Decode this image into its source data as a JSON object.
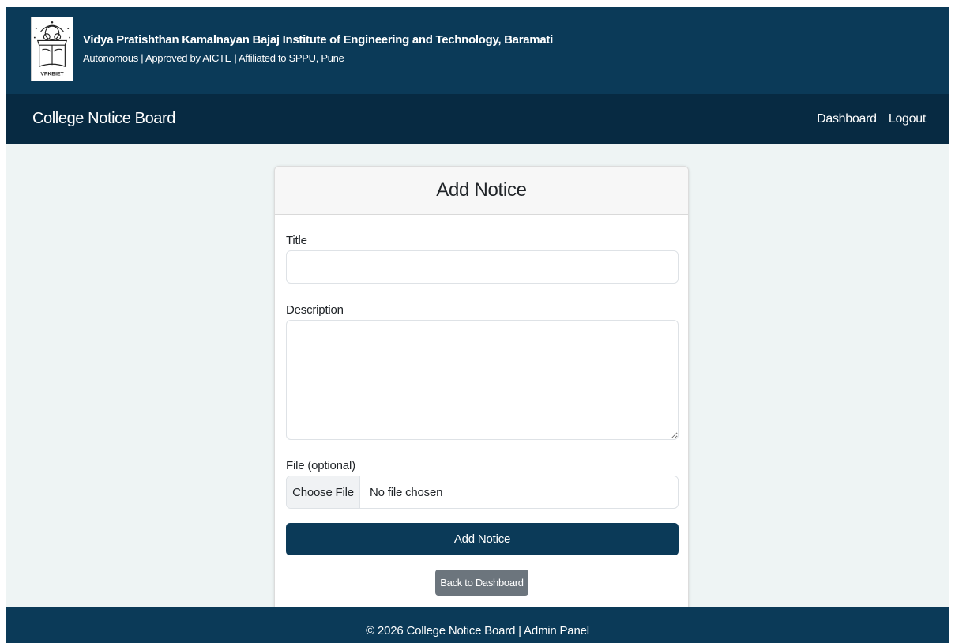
{
  "header": {
    "institute_name": "Vidya Pratishthan Kamalnayan Bajaj Institute of Engineering and Technology, Baramati",
    "institute_subtitle": "Autonomous | Approved by AICTE | Affiliated to SPPU, Pune",
    "logo_text": "VPKBIET",
    "logo_icon": "college-emblem"
  },
  "navbar": {
    "brand": "College Notice Board",
    "links": [
      "Dashboard",
      "Logout"
    ]
  },
  "form": {
    "heading": "Add Notice",
    "title_label": "Title",
    "title_value": "",
    "description_label": "Description",
    "description_value": "",
    "file_label": "File (optional)",
    "file_button": "Choose File",
    "file_status": "No file chosen",
    "submit_label": "Add Notice",
    "back_label": "Back to Dashboard"
  },
  "footer": {
    "text": "© 2026 College Notice Board | Admin Panel"
  },
  "colors": {
    "header_bg": "#0b3a58",
    "navbar_bg": "#072a42",
    "page_bg": "#eef4f4",
    "back_button": "#6c757d"
  }
}
